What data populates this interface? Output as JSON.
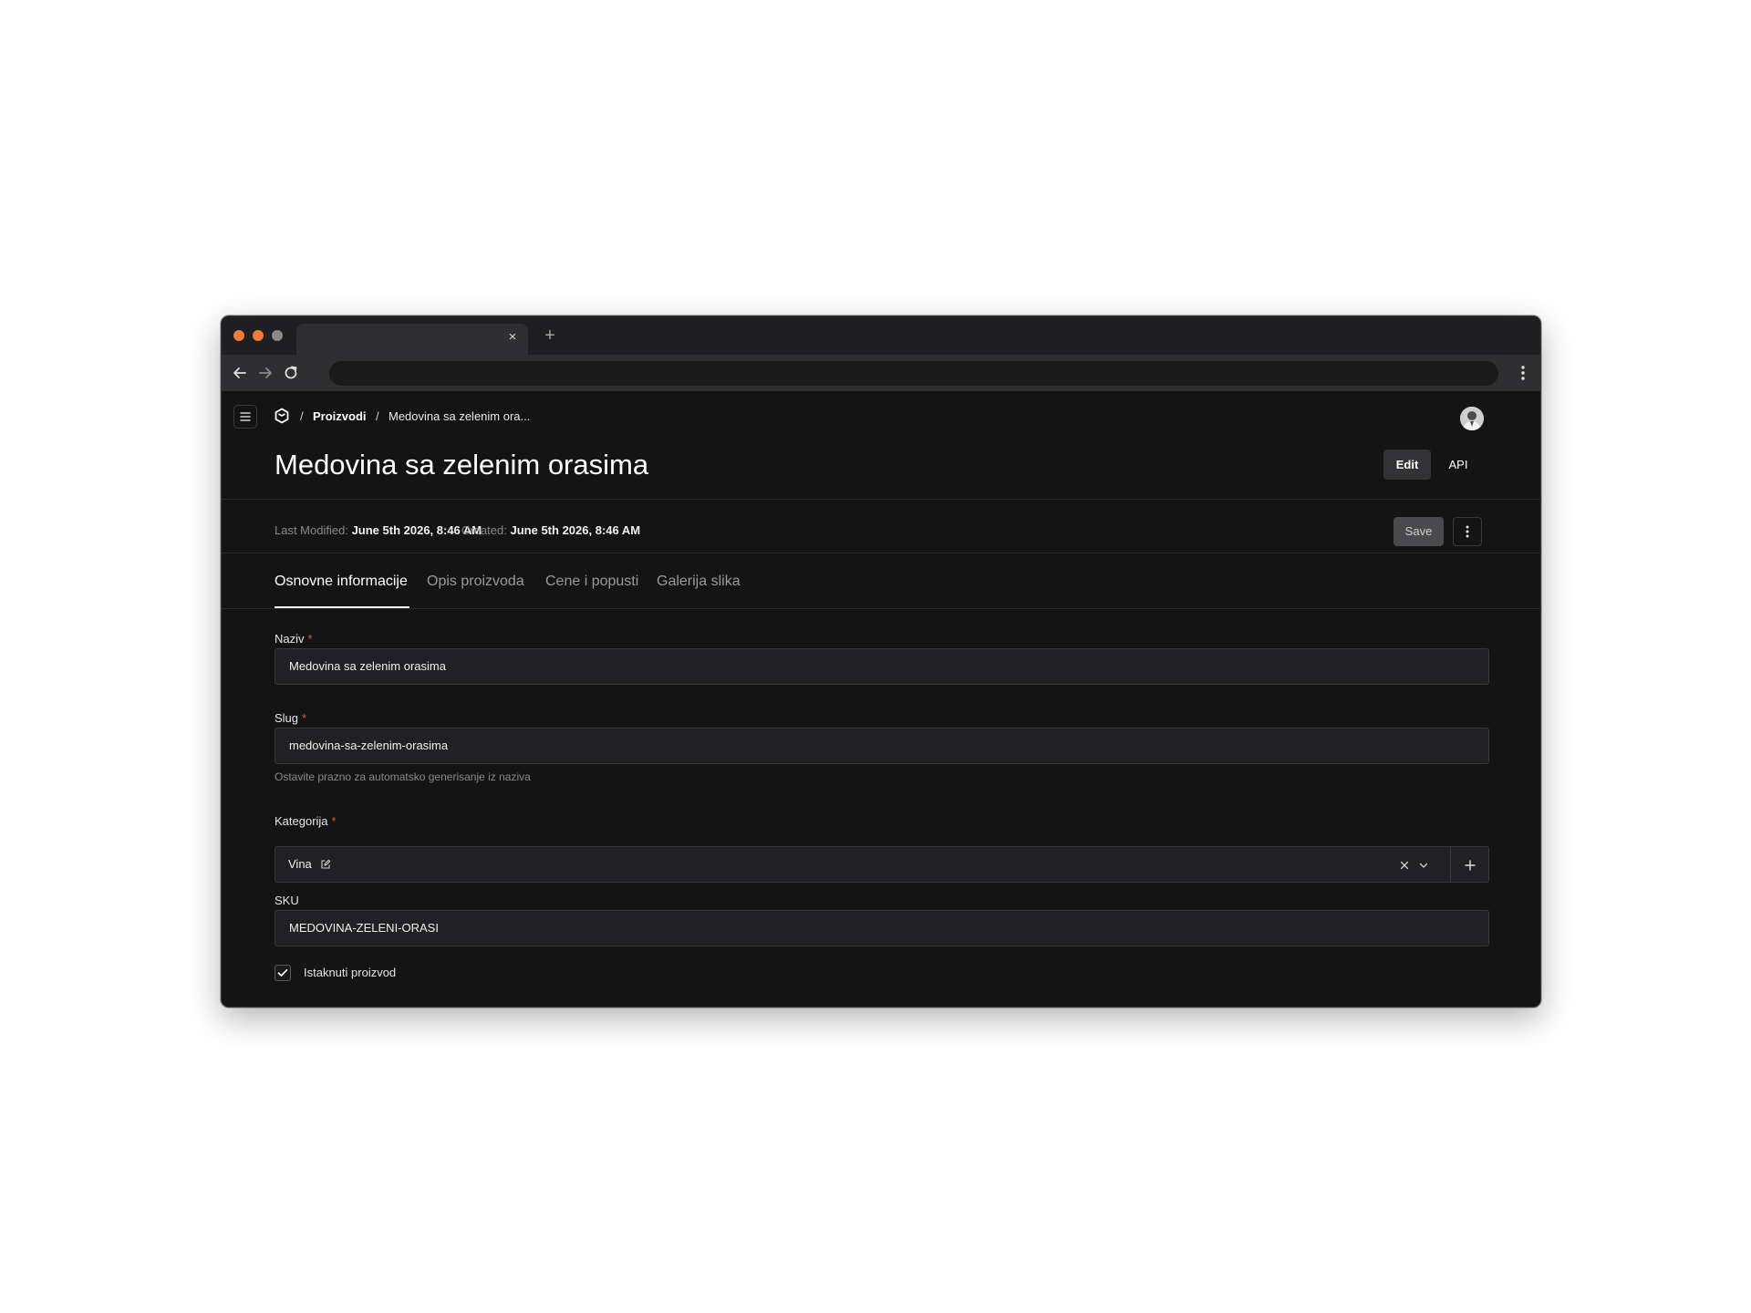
{
  "browser": {
    "tab_title": "",
    "tab_close": "×",
    "new_tab": "+",
    "url": ""
  },
  "breadcrumb": {
    "separator": "/",
    "items": [
      "Proizvodi",
      "Medovina sa zelenim ora..."
    ]
  },
  "page": {
    "title": "Medovina sa zelenim orasima",
    "edit_label": "Edit",
    "api_label": "API"
  },
  "meta": {
    "last_modified_label": "Last Modified:",
    "last_modified_value": "June 5th 2026, 8:46 AM",
    "created_label": "Created:",
    "created_value": "June 5th 2026, 8:46 AM",
    "save_label": "Save"
  },
  "tabs": [
    {
      "label": "Osnovne informacije",
      "active": true
    },
    {
      "label": "Opis proizvoda",
      "active": false
    },
    {
      "label": "Cene i popusti",
      "active": false
    },
    {
      "label": "Galerija slika",
      "active": false
    }
  ],
  "form": {
    "naziv": {
      "label": "Naziv",
      "required_mark": "*",
      "value": "Medovina sa zelenim orasima"
    },
    "slug": {
      "label": "Slug",
      "required_mark": "*",
      "value": "medovina-sa-zelenim-orasima",
      "hint": "Ostavite prazno za automatsko generisanje iz naziva"
    },
    "kategorija": {
      "label": "Kategorija",
      "required_mark": "*",
      "value": "Vina"
    },
    "sku": {
      "label": "SKU",
      "value": "MEDOVINA-ZELENI-ORASI"
    },
    "istaknuti": {
      "label": "Istaknuti proizvod",
      "checked": true
    }
  },
  "colors": {
    "background": "#141414",
    "accent_dot": "#ee7b3a",
    "required": "#e8534a"
  }
}
